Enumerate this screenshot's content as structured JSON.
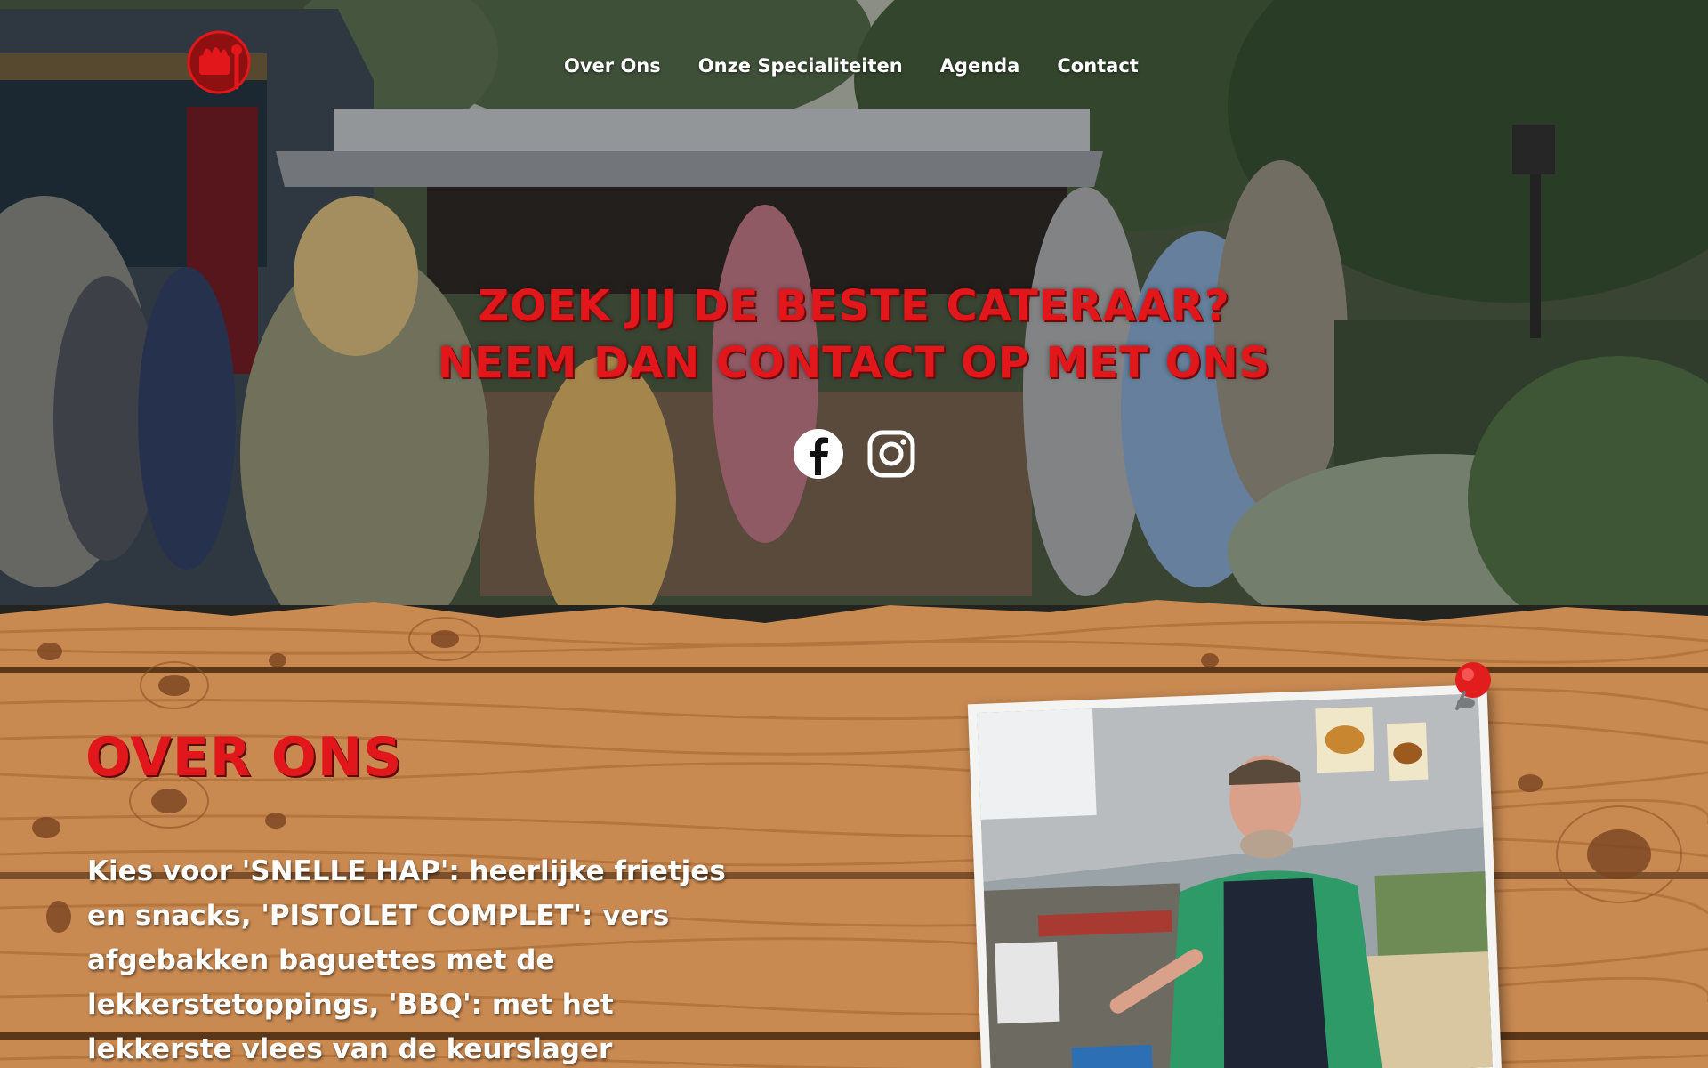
{
  "nav": {
    "logo_icon": "food-truck-logo-icon",
    "items": [
      {
        "label": "Over Ons"
      },
      {
        "label": "Onze Specialiteiten"
      },
      {
        "label": "Agenda"
      },
      {
        "label": "Contact"
      }
    ]
  },
  "hero": {
    "headline_line1": "Zoek jij de beste cateraar?",
    "headline_line2": "Neem dan contact op met ons",
    "social": [
      {
        "icon": "facebook-icon"
      },
      {
        "icon": "instagram-icon"
      }
    ]
  },
  "about": {
    "title": "Over Ons",
    "text": "Kies voor 'SNELLE HAP': heerlijke frietjes en snacks, 'PISTOLET COMPLET': vers afgebakken baguettes met de lekkerstetoppings, 'BBQ': met het lekkerste vlees van de keurslager"
  },
  "colors": {
    "accent_red": "#e1171c",
    "wood": "#c98a52",
    "text_white": "#ffffff"
  }
}
